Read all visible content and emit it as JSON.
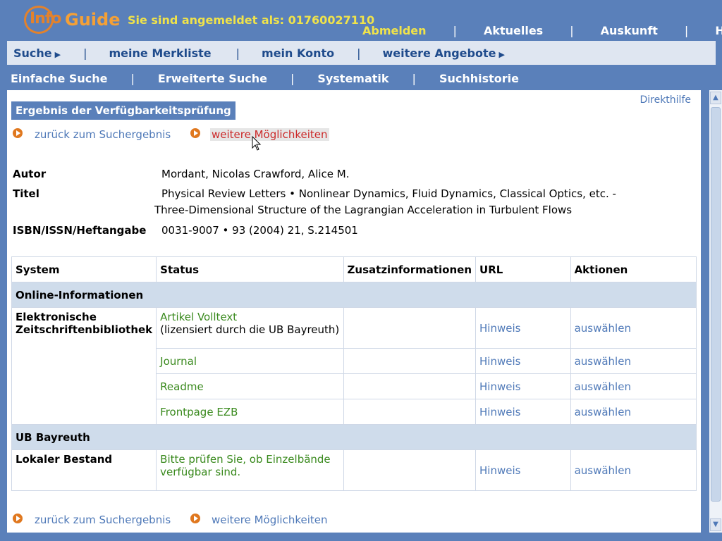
{
  "header": {
    "logo_text_info": "Info",
    "logo_text_guide": "Guide",
    "login_status": "Sie sind angemeldet als: 01760027110",
    "links": [
      "Abmelden",
      "Aktuelles",
      "Auskunft",
      "Hilfe"
    ]
  },
  "mainnav": {
    "items": [
      "Suche",
      "meine Merkliste",
      "mein Konto",
      "weitere Angebote"
    ]
  },
  "subnav": {
    "items": [
      "Einfache Suche",
      "Erweiterte Suche",
      "Systematik",
      "Suchhistorie"
    ]
  },
  "content": {
    "direkthilfe": "Direkthilfe",
    "result_title": "Ergebnis der Verfügbarkeitsprüfung",
    "back_link": "zurück zum Suchergebnis",
    "more_link": "weitere Möglichkeiten",
    "meta": {
      "author_label": "Autor",
      "author_value": "Mordant, Nicolas Crawford, Alice M.",
      "title_label": "Titel",
      "title_value_1": "Physical Review Letters  • Nonlinear Dynamics, Fluid Dynamics, Classical Optics, etc. -",
      "title_value_2": "Three-Dimensional Structure of the Lagrangian Acceleration in Turbulent Flows",
      "isbn_label": "ISBN/ISSN/Heftangabe",
      "isbn_value": "0031-9007  • 93 (2004) 21, S.214501"
    },
    "table": {
      "headers": [
        "System",
        "Status",
        "Zusatzinformationen",
        "URL",
        "Aktionen"
      ],
      "section_online": "Online-Informationen",
      "ezb_system_1": "Elektronische",
      "ezb_system_2": "Zeitschriftenbibliothek",
      "rows": [
        {
          "status": "Artikel Volltext",
          "status_sub": "(lizensiert durch die UB Bayreuth)",
          "url": "Hinweis",
          "action": "auswählen"
        },
        {
          "status": "Journal",
          "url": "Hinweis",
          "action": "auswählen"
        },
        {
          "status": "Readme",
          "url": "Hinweis",
          "action": "auswählen"
        },
        {
          "status": "Frontpage EZB",
          "url": "Hinweis",
          "action": "auswählen"
        }
      ],
      "section_ub": "UB Bayreuth",
      "local_system": "Lokaler Bestand",
      "local_status_1": "Bitte prüfen Sie, ob Einzelbände",
      "local_status_2": "verfügbar sind.",
      "local_url": "Hinweis",
      "local_action": "auswählen"
    }
  },
  "colors": {
    "background": "#5a80ba",
    "accent_orange": "#e0781f",
    "login_yellow": "#f0e34a",
    "link_blue": "#4f79b8",
    "status_green": "#3a8a1e",
    "hover_red": "#cc2a2a"
  }
}
